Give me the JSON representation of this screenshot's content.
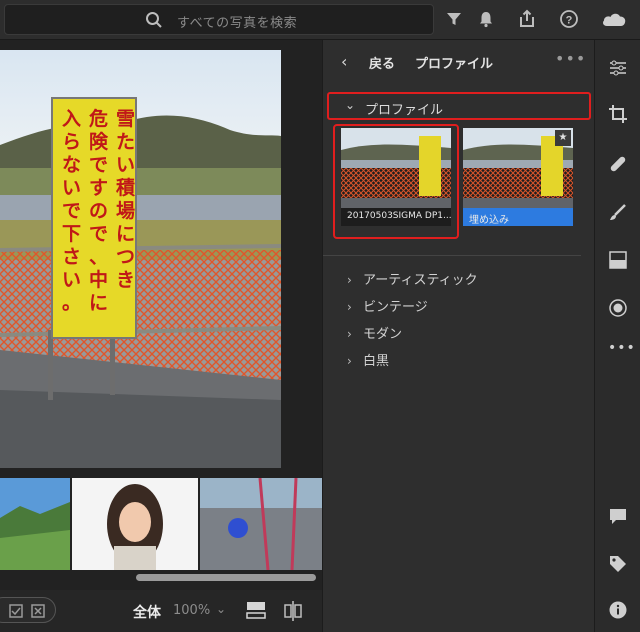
{
  "search": {
    "placeholder": "すべての写真を検索"
  },
  "top_icons": [
    "search-icon",
    "filter-icon",
    "bell-icon",
    "share-icon",
    "help-icon",
    "cloud-icon"
  ],
  "panel": {
    "back_label": "戻る",
    "title": "プロファイル",
    "section_label": "プロファイル",
    "profiles": [
      {
        "label": "20170503SIGMA DP1..."
      },
      {
        "label": "埋め込み",
        "selected": true
      }
    ],
    "categories": [
      {
        "label": "アーティスティック"
      },
      {
        "label": "ビンテージ"
      },
      {
        "label": "モダン"
      },
      {
        "label": "白黒"
      }
    ]
  },
  "sign_text": [
    "雪たい積場につき",
    "危険ですので、中に",
    "入らないで下さい。"
  ],
  "bottom": {
    "view_label": "全体",
    "zoom": "100%"
  },
  "tools": [
    "sliders-icon",
    "crop-icon",
    "bandage-icon",
    "brush-icon",
    "gradient-icon",
    "radial-icon",
    "more-dots-icon",
    "comment-icon",
    "tag-icon",
    "info-icon"
  ]
}
